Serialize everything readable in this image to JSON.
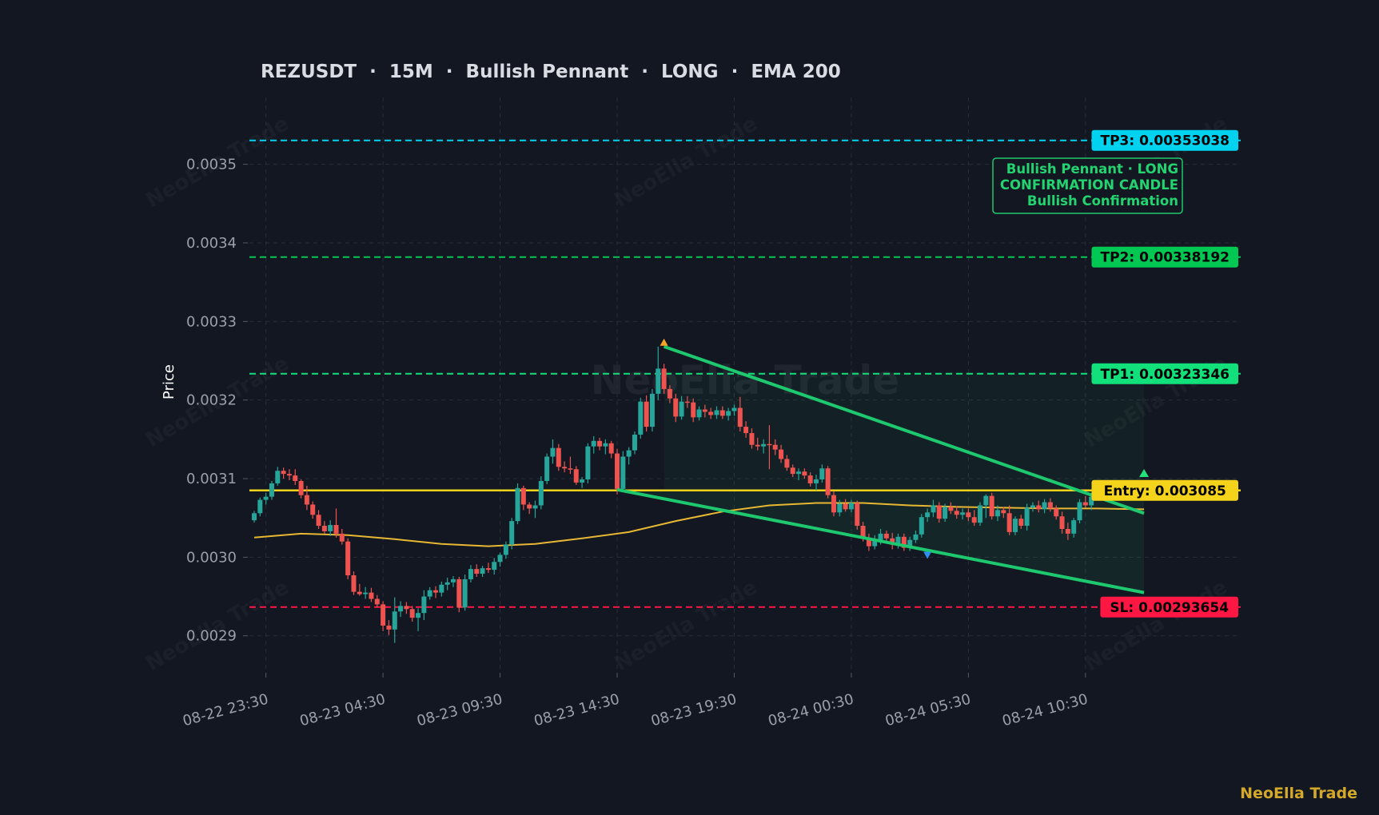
{
  "chart_data": {
    "type": "candlestick",
    "title": "REZUSDT  ·  15M  ·  Bullish Pennant  ·  LONG  ·  EMA 200",
    "ylabel": "Price",
    "xlabel": "",
    "ylim": [
      0.002855,
      0.003585
    ],
    "time_start": "2025-08-22 23:00",
    "time_end": "2025-08-24 14:30",
    "interval_minutes": 15,
    "x_ticks": [
      {
        "t": "2025-08-22 23:30",
        "label": "08-22 23:30"
      },
      {
        "t": "2025-08-23 04:30",
        "label": "08-23 04:30"
      },
      {
        "t": "2025-08-23 09:30",
        "label": "08-23 09:30"
      },
      {
        "t": "2025-08-23 14:30",
        "label": "08-23 14:30"
      },
      {
        "t": "2025-08-23 19:30",
        "label": "08-23 19:30"
      },
      {
        "t": "2025-08-24 00:30",
        "label": "08-24 00:30"
      },
      {
        "t": "2025-08-24 05:30",
        "label": "08-24 05:30"
      },
      {
        "t": "2025-08-24 10:30",
        "label": "08-24 10:30"
      }
    ],
    "y_ticks": [
      {
        "v": 0.0029,
        "label": "0.0029"
      },
      {
        "v": 0.003,
        "label": "0.0030"
      },
      {
        "v": 0.0031,
        "label": "0.0031"
      },
      {
        "v": 0.0032,
        "label": "0.0032"
      },
      {
        "v": 0.0033,
        "label": "0.0033"
      },
      {
        "v": 0.0034,
        "label": "0.0034"
      },
      {
        "v": 0.0035,
        "label": "0.0035"
      }
    ],
    "grid": true,
    "levels": [
      {
        "name": "TP3",
        "label": "TP3: 0.00353038",
        "value": 0.00353038,
        "color": "#00d2f0",
        "style": "dashed"
      },
      {
        "name": "TP2",
        "label": "TP2: 0.00338192",
        "value": 0.00338192,
        "color": "#00c853",
        "style": "dashed"
      },
      {
        "name": "TP1",
        "label": "TP1: 0.00323346",
        "value": 0.00323346,
        "color": "#12e07a",
        "style": "dashed"
      },
      {
        "name": "Entry",
        "label": "Entry: 0.003085",
        "value": 0.003085,
        "color": "#f4d31a",
        "style": "solid"
      },
      {
        "name": "SL",
        "label": "SL: 0.00293654",
        "value": 0.00293654,
        "color": "#ff1744",
        "style": "dashed"
      }
    ],
    "pattern": {
      "upper": [
        {
          "t": "2025-08-23 16:30",
          "v": 0.003268
        },
        {
          "t": "2025-08-24 13:00",
          "v": 0.003056
        }
      ],
      "lower": [
        {
          "t": "2025-08-23 14:30",
          "v": 0.003086
        },
        {
          "t": "2025-08-24 13:00",
          "v": 0.002955
        }
      ],
      "channel_top": 0.003235,
      "channel_bottom": 0.003085,
      "channel_start": "2025-08-23 16:30",
      "channel_end": "2025-08-24 13:00",
      "pivot_high": {
        "t": "2025-08-23 16:30",
        "v": 0.003268
      },
      "pivot_low": {
        "t": "2025-08-24 03:45",
        "v": 0.003008
      },
      "signal": {
        "t": "2025-08-24 13:00",
        "v": 0.003102
      },
      "color": "#1ec86e"
    },
    "annotation": [
      "Bullish Pennant · LONG",
      "CONFIRMATION CANDLE",
      "Bullish Confirmation"
    ],
    "ema": {
      "name": "EMA 200",
      "color": "#e8b833",
      "points": [
        {
          "t": "2025-08-22 23:00",
          "v": 0.003025
        },
        {
          "t": "2025-08-23 01:00",
          "v": 0.00303
        },
        {
          "t": "2025-08-23 03:00",
          "v": 0.003028
        },
        {
          "t": "2025-08-23 05:00",
          "v": 0.003023
        },
        {
          "t": "2025-08-23 07:00",
          "v": 0.003017
        },
        {
          "t": "2025-08-23 09:00",
          "v": 0.003014
        },
        {
          "t": "2025-08-23 11:00",
          "v": 0.003017
        },
        {
          "t": "2025-08-23 13:00",
          "v": 0.003024
        },
        {
          "t": "2025-08-23 15:00",
          "v": 0.003032
        },
        {
          "t": "2025-08-23 17:00",
          "v": 0.003046
        },
        {
          "t": "2025-08-23 19:00",
          "v": 0.003058
        },
        {
          "t": "2025-08-23 21:00",
          "v": 0.003066
        },
        {
          "t": "2025-08-23 23:00",
          "v": 0.003069
        },
        {
          "t": "2025-08-24 01:00",
          "v": 0.003069
        },
        {
          "t": "2025-08-24 03:00",
          "v": 0.003066
        },
        {
          "t": "2025-08-24 05:00",
          "v": 0.003064
        },
        {
          "t": "2025-08-24 07:00",
          "v": 0.003063
        },
        {
          "t": "2025-08-24 09:00",
          "v": 0.003062
        },
        {
          "t": "2025-08-24 11:00",
          "v": 0.003062
        },
        {
          "t": "2025-08-24 13:00",
          "v": 0.003061
        }
      ]
    },
    "candle_colors": {
      "up": "#26a69a",
      "down": "#ef5350"
    },
    "candles": [
      [
        0.003047,
        0.003059,
        0.003044,
        0.003056
      ],
      [
        0.003056,
        0.003076,
        0.003052,
        0.003073
      ],
      [
        0.003073,
        0.003082,
        0.003067,
        0.003077
      ],
      [
        0.003077,
        0.003097,
        0.003073,
        0.003094
      ],
      [
        0.003094,
        0.003115,
        0.003091,
        0.00311
      ],
      [
        0.00311,
        0.003114,
        0.0031,
        0.003106
      ],
      [
        0.003106,
        0.003112,
        0.003098,
        0.003104
      ],
      [
        0.003104,
        0.003112,
        0.003092,
        0.003097
      ],
      [
        0.003097,
        0.003099,
        0.003075,
        0.003079
      ],
      [
        0.003079,
        0.003091,
        0.00306,
        0.003067
      ],
      [
        0.003067,
        0.003071,
        0.003049,
        0.003054
      ],
      [
        0.003054,
        0.00306,
        0.003036,
        0.00304
      ],
      [
        0.00304,
        0.003046,
        0.00303,
        0.003033
      ],
      [
        0.003033,
        0.003047,
        0.003027,
        0.003041
      ],
      [
        0.003041,
        0.003062,
        0.003025,
        0.00303
      ],
      [
        0.00303,
        0.003036,
        0.003016,
        0.00302
      ],
      [
        0.00302,
        0.003024,
        0.002972,
        0.002977
      ],
      [
        0.002977,
        0.002982,
        0.002952,
        0.002956
      ],
      [
        0.002956,
        0.002966,
        0.002951,
        0.002953
      ],
      [
        0.002953,
        0.002962,
        0.002947,
        0.002955
      ],
      [
        0.002955,
        0.002961,
        0.002943,
        0.002947
      ],
      [
        0.002947,
        0.002952,
        0.002936,
        0.00294
      ],
      [
        0.00294,
        0.002944,
        0.002906,
        0.002913
      ],
      [
        0.002913,
        0.00292,
        0.002901,
        0.002908
      ],
      [
        0.002908,
        0.002949,
        0.002891,
        0.002931
      ],
      [
        0.002931,
        0.002944,
        0.002924,
        0.002938
      ],
      [
        0.002938,
        0.002943,
        0.002928,
        0.002934
      ],
      [
        0.002934,
        0.002938,
        0.002918,
        0.002923
      ],
      [
        0.002923,
        0.002935,
        0.002906,
        0.002929
      ],
      [
        0.002929,
        0.002958,
        0.00292,
        0.00295
      ],
      [
        0.00295,
        0.002962,
        0.002946,
        0.002958
      ],
      [
        0.002958,
        0.002963,
        0.002948,
        0.002955
      ],
      [
        0.002955,
        0.002969,
        0.00295,
        0.002965
      ],
      [
        0.002965,
        0.002974,
        0.002958,
        0.002968
      ],
      [
        0.002968,
        0.002976,
        0.002962,
        0.002972
      ],
      [
        0.002972,
        0.002975,
        0.00293,
        0.002936
      ],
      [
        0.002936,
        0.002978,
        0.002932,
        0.002972
      ],
      [
        0.002972,
        0.00299,
        0.002968,
        0.002985
      ],
      [
        0.002985,
        0.002991,
        0.002975,
        0.002979
      ],
      [
        0.002979,
        0.002989,
        0.002975,
        0.002986
      ],
      [
        0.002986,
        0.002993,
        0.00298,
        0.002984
      ],
      [
        0.002984,
        0.002999,
        0.002978,
        0.002994
      ],
      [
        0.002994,
        0.003006,
        0.002988,
        0.003003
      ],
      [
        0.003003,
        0.00302,
        0.002998,
        0.003016
      ],
      [
        0.003016,
        0.00305,
        0.00301,
        0.003046
      ],
      [
        0.003046,
        0.003094,
        0.003042,
        0.003088
      ],
      [
        0.003088,
        0.003091,
        0.00306,
        0.003067
      ],
      [
        0.003067,
        0.00307,
        0.003055,
        0.003062
      ],
      [
        0.003062,
        0.003072,
        0.00305,
        0.003066
      ],
      [
        0.003066,
        0.003103,
        0.003061,
        0.003097
      ],
      [
        0.003097,
        0.003132,
        0.003093,
        0.003128
      ],
      [
        0.003128,
        0.00315,
        0.003119,
        0.003139
      ],
      [
        0.003139,
        0.003144,
        0.00311,
        0.003115
      ],
      [
        0.003115,
        0.003122,
        0.003108,
        0.003113
      ],
      [
        0.003113,
        0.003128,
        0.003106,
        0.003112
      ],
      [
        0.003112,
        0.003116,
        0.003092,
        0.003095
      ],
      [
        0.003095,
        0.003102,
        0.003088,
        0.003099
      ],
      [
        0.003099,
        0.003145,
        0.003094,
        0.003141
      ],
      [
        0.003141,
        0.003154,
        0.003132,
        0.003148
      ],
      [
        0.003148,
        0.003152,
        0.003136,
        0.003141
      ],
      [
        0.003141,
        0.00315,
        0.003131,
        0.003145
      ],
      [
        0.003145,
        0.003148,
        0.003126,
        0.003132
      ],
      [
        0.003132,
        0.003138,
        0.00308,
        0.003087
      ],
      [
        0.003087,
        0.003135,
        0.003084,
        0.003128
      ],
      [
        0.003128,
        0.00314,
        0.003118,
        0.003136
      ],
      [
        0.003136,
        0.00316,
        0.003131,
        0.003156
      ],
      [
        0.003156,
        0.003203,
        0.003151,
        0.003198
      ],
      [
        0.003198,
        0.003206,
        0.00316,
        0.003166
      ],
      [
        0.003166,
        0.003214,
        0.00316,
        0.003208
      ],
      [
        0.003208,
        0.003268,
        0.0032,
        0.00324
      ],
      [
        0.00324,
        0.003246,
        0.003208,
        0.003214
      ],
      [
        0.003214,
        0.003219,
        0.003196,
        0.003202
      ],
      [
        0.003202,
        0.003208,
        0.003172,
        0.003179
      ],
      [
        0.003179,
        0.003205,
        0.003175,
        0.003198
      ],
      [
        0.003198,
        0.003205,
        0.00319,
        0.003197
      ],
      [
        0.003197,
        0.003202,
        0.003172,
        0.003178
      ],
      [
        0.003178,
        0.003192,
        0.003174,
        0.003188
      ],
      [
        0.003188,
        0.003194,
        0.003178,
        0.003185
      ],
      [
        0.003185,
        0.00319,
        0.003176,
        0.003181
      ],
      [
        0.003181,
        0.003192,
        0.003176,
        0.003187
      ],
      [
        0.003187,
        0.003192,
        0.003176,
        0.00318
      ],
      [
        0.00318,
        0.00319,
        0.003174,
        0.003186
      ],
      [
        0.003186,
        0.003194,
        0.00318,
        0.00319
      ],
      [
        0.00319,
        0.003204,
        0.00316,
        0.003166
      ],
      [
        0.003166,
        0.003173,
        0.003152,
        0.003158
      ],
      [
        0.003158,
        0.003164,
        0.003138,
        0.003143
      ],
      [
        0.003143,
        0.003152,
        0.003136,
        0.003141
      ],
      [
        0.003141,
        0.00315,
        0.003132,
        0.003144
      ],
      [
        0.003144,
        0.003168,
        0.003112,
        0.003143
      ],
      [
        0.003143,
        0.00315,
        0.00313,
        0.003137
      ],
      [
        0.003137,
        0.003143,
        0.00312,
        0.003125
      ],
      [
        0.003125,
        0.00313,
        0.00311,
        0.003114
      ],
      [
        0.003114,
        0.003118,
        0.003102,
        0.003106
      ],
      [
        0.003106,
        0.003113,
        0.003098,
        0.003109
      ],
      [
        0.003109,
        0.003113,
        0.0031,
        0.003104
      ],
      [
        0.003104,
        0.003108,
        0.00309,
        0.003094
      ],
      [
        0.003094,
        0.003105,
        0.003085,
        0.003099
      ],
      [
        0.003099,
        0.003118,
        0.003095,
        0.003113
      ],
      [
        0.003113,
        0.003116,
        0.003075,
        0.003079
      ],
      [
        0.003079,
        0.003084,
        0.003052,
        0.003057
      ],
      [
        0.003057,
        0.003073,
        0.003052,
        0.003068
      ],
      [
        0.003068,
        0.003074,
        0.003058,
        0.003061
      ],
      [
        0.003061,
        0.003073,
        0.003057,
        0.003069
      ],
      [
        0.003069,
        0.003072,
        0.003035,
        0.00304
      ],
      [
        0.00304,
        0.003045,
        0.00302,
        0.003025
      ],
      [
        0.003025,
        0.00303,
        0.003008,
        0.003014
      ],
      [
        0.003014,
        0.003028,
        0.00301,
        0.003022
      ],
      [
        0.003022,
        0.003036,
        0.003016,
        0.00303
      ],
      [
        0.00303,
        0.003034,
        0.003018,
        0.003024
      ],
      [
        0.003024,
        0.003031,
        0.00301,
        0.003016
      ],
      [
        0.003016,
        0.00303,
        0.003011,
        0.003026
      ],
      [
        0.003026,
        0.00303,
        0.003008,
        0.003012
      ],
      [
        0.003012,
        0.003026,
        0.003008,
        0.003022
      ],
      [
        0.003022,
        0.003034,
        0.003018,
        0.003029
      ],
      [
        0.003029,
        0.003055,
        0.003025,
        0.003051
      ],
      [
        0.003051,
        0.003062,
        0.003045,
        0.003057
      ],
      [
        0.003057,
        0.003073,
        0.003051,
        0.003066
      ],
      [
        0.003066,
        0.00307,
        0.003044,
        0.003049
      ],
      [
        0.003049,
        0.003068,
        0.003045,
        0.003064
      ],
      [
        0.003064,
        0.00307,
        0.003055,
        0.003059
      ],
      [
        0.003059,
        0.003065,
        0.003049,
        0.003054
      ],
      [
        0.003054,
        0.003062,
        0.003048,
        0.003057
      ],
      [
        0.003057,
        0.003062,
        0.003046,
        0.003051
      ],
      [
        0.003051,
        0.00306,
        0.00304,
        0.003044
      ],
      [
        0.003044,
        0.00307,
        0.00304,
        0.003066
      ],
      [
        0.003066,
        0.00308,
        0.00305,
        0.003078
      ],
      [
        0.003078,
        0.003082,
        0.003048,
        0.003052
      ],
      [
        0.003052,
        0.003066,
        0.003046,
        0.00306
      ],
      [
        0.00306,
        0.003064,
        0.00305,
        0.003056
      ],
      [
        0.003056,
        0.003066,
        0.003028,
        0.003032
      ],
      [
        0.003032,
        0.003052,
        0.003028,
        0.003049
      ],
      [
        0.003049,
        0.003054,
        0.003036,
        0.00304
      ],
      [
        0.00304,
        0.003068,
        0.003034,
        0.003063
      ],
      [
        0.003063,
        0.00307,
        0.003058,
        0.003066
      ],
      [
        0.003066,
        0.003072,
        0.003057,
        0.003061
      ],
      [
        0.003061,
        0.003074,
        0.003056,
        0.00307
      ],
      [
        0.00307,
        0.003075,
        0.003058,
        0.003062
      ],
      [
        0.003062,
        0.003066,
        0.003048,
        0.003052
      ],
      [
        0.003052,
        0.003058,
        0.00303,
        0.003036
      ],
      [
        0.003036,
        0.003044,
        0.003022,
        0.00303
      ],
      [
        0.00303,
        0.00305,
        0.003025,
        0.003047
      ],
      [
        0.003047,
        0.003074,
        0.003043,
        0.00307
      ],
      [
        0.00307,
        0.003078,
        0.003063,
        0.003066
      ],
      [
        0.003066,
        0.003082,
        0.00306,
        0.003077
      ]
    ]
  },
  "watermark": {
    "text": "NeoElla Trade"
  },
  "brand": {
    "label": "NeoElla Trade"
  }
}
